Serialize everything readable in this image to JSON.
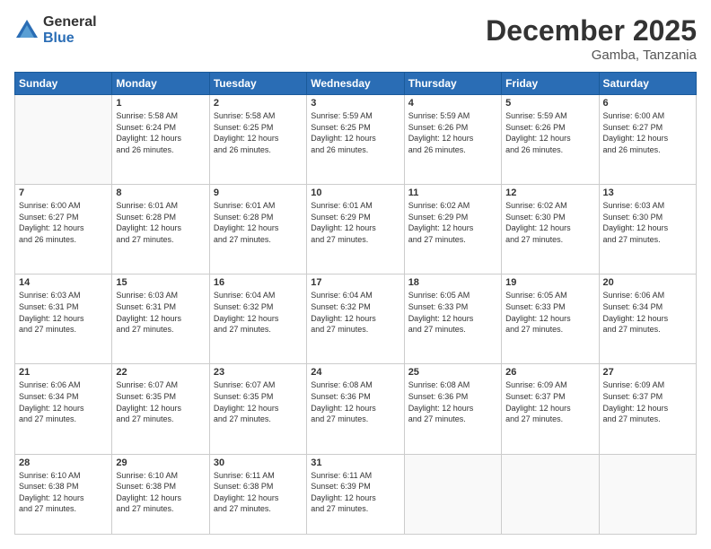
{
  "logo": {
    "general": "General",
    "blue": "Blue"
  },
  "header": {
    "month": "December 2025",
    "location": "Gamba, Tanzania"
  },
  "weekdays": [
    "Sunday",
    "Monday",
    "Tuesday",
    "Wednesday",
    "Thursday",
    "Friday",
    "Saturday"
  ],
  "weeks": [
    [
      {
        "day": "",
        "sunrise": "",
        "sunset": "",
        "daylight": ""
      },
      {
        "day": "1",
        "sunrise": "Sunrise: 5:58 AM",
        "sunset": "Sunset: 6:24 PM",
        "daylight": "Daylight: 12 hours and 26 minutes."
      },
      {
        "day": "2",
        "sunrise": "Sunrise: 5:58 AM",
        "sunset": "Sunset: 6:25 PM",
        "daylight": "Daylight: 12 hours and 26 minutes."
      },
      {
        "day": "3",
        "sunrise": "Sunrise: 5:59 AM",
        "sunset": "Sunset: 6:25 PM",
        "daylight": "Daylight: 12 hours and 26 minutes."
      },
      {
        "day": "4",
        "sunrise": "Sunrise: 5:59 AM",
        "sunset": "Sunset: 6:26 PM",
        "daylight": "Daylight: 12 hours and 26 minutes."
      },
      {
        "day": "5",
        "sunrise": "Sunrise: 5:59 AM",
        "sunset": "Sunset: 6:26 PM",
        "daylight": "Daylight: 12 hours and 26 minutes."
      },
      {
        "day": "6",
        "sunrise": "Sunrise: 6:00 AM",
        "sunset": "Sunset: 6:27 PM",
        "daylight": "Daylight: 12 hours and 26 minutes."
      }
    ],
    [
      {
        "day": "7",
        "sunrise": "Sunrise: 6:00 AM",
        "sunset": "Sunset: 6:27 PM",
        "daylight": "Daylight: 12 hours and 26 minutes."
      },
      {
        "day": "8",
        "sunrise": "Sunrise: 6:01 AM",
        "sunset": "Sunset: 6:28 PM",
        "daylight": "Daylight: 12 hours and 27 minutes."
      },
      {
        "day": "9",
        "sunrise": "Sunrise: 6:01 AM",
        "sunset": "Sunset: 6:28 PM",
        "daylight": "Daylight: 12 hours and 27 minutes."
      },
      {
        "day": "10",
        "sunrise": "Sunrise: 6:01 AM",
        "sunset": "Sunset: 6:29 PM",
        "daylight": "Daylight: 12 hours and 27 minutes."
      },
      {
        "day": "11",
        "sunrise": "Sunrise: 6:02 AM",
        "sunset": "Sunset: 6:29 PM",
        "daylight": "Daylight: 12 hours and 27 minutes."
      },
      {
        "day": "12",
        "sunrise": "Sunrise: 6:02 AM",
        "sunset": "Sunset: 6:30 PM",
        "daylight": "Daylight: 12 hours and 27 minutes."
      },
      {
        "day": "13",
        "sunrise": "Sunrise: 6:03 AM",
        "sunset": "Sunset: 6:30 PM",
        "daylight": "Daylight: 12 hours and 27 minutes."
      }
    ],
    [
      {
        "day": "14",
        "sunrise": "Sunrise: 6:03 AM",
        "sunset": "Sunset: 6:31 PM",
        "daylight": "Daylight: 12 hours and 27 minutes."
      },
      {
        "day": "15",
        "sunrise": "Sunrise: 6:03 AM",
        "sunset": "Sunset: 6:31 PM",
        "daylight": "Daylight: 12 hours and 27 minutes."
      },
      {
        "day": "16",
        "sunrise": "Sunrise: 6:04 AM",
        "sunset": "Sunset: 6:32 PM",
        "daylight": "Daylight: 12 hours and 27 minutes."
      },
      {
        "day": "17",
        "sunrise": "Sunrise: 6:04 AM",
        "sunset": "Sunset: 6:32 PM",
        "daylight": "Daylight: 12 hours and 27 minutes."
      },
      {
        "day": "18",
        "sunrise": "Sunrise: 6:05 AM",
        "sunset": "Sunset: 6:33 PM",
        "daylight": "Daylight: 12 hours and 27 minutes."
      },
      {
        "day": "19",
        "sunrise": "Sunrise: 6:05 AM",
        "sunset": "Sunset: 6:33 PM",
        "daylight": "Daylight: 12 hours and 27 minutes."
      },
      {
        "day": "20",
        "sunrise": "Sunrise: 6:06 AM",
        "sunset": "Sunset: 6:34 PM",
        "daylight": "Daylight: 12 hours and 27 minutes."
      }
    ],
    [
      {
        "day": "21",
        "sunrise": "Sunrise: 6:06 AM",
        "sunset": "Sunset: 6:34 PM",
        "daylight": "Daylight: 12 hours and 27 minutes."
      },
      {
        "day": "22",
        "sunrise": "Sunrise: 6:07 AM",
        "sunset": "Sunset: 6:35 PM",
        "daylight": "Daylight: 12 hours and 27 minutes."
      },
      {
        "day": "23",
        "sunrise": "Sunrise: 6:07 AM",
        "sunset": "Sunset: 6:35 PM",
        "daylight": "Daylight: 12 hours and 27 minutes."
      },
      {
        "day": "24",
        "sunrise": "Sunrise: 6:08 AM",
        "sunset": "Sunset: 6:36 PM",
        "daylight": "Daylight: 12 hours and 27 minutes."
      },
      {
        "day": "25",
        "sunrise": "Sunrise: 6:08 AM",
        "sunset": "Sunset: 6:36 PM",
        "daylight": "Daylight: 12 hours and 27 minutes."
      },
      {
        "day": "26",
        "sunrise": "Sunrise: 6:09 AM",
        "sunset": "Sunset: 6:37 PM",
        "daylight": "Daylight: 12 hours and 27 minutes."
      },
      {
        "day": "27",
        "sunrise": "Sunrise: 6:09 AM",
        "sunset": "Sunset: 6:37 PM",
        "daylight": "Daylight: 12 hours and 27 minutes."
      }
    ],
    [
      {
        "day": "28",
        "sunrise": "Sunrise: 6:10 AM",
        "sunset": "Sunset: 6:38 PM",
        "daylight": "Daylight: 12 hours and 27 minutes."
      },
      {
        "day": "29",
        "sunrise": "Sunrise: 6:10 AM",
        "sunset": "Sunset: 6:38 PM",
        "daylight": "Daylight: 12 hours and 27 minutes."
      },
      {
        "day": "30",
        "sunrise": "Sunrise: 6:11 AM",
        "sunset": "Sunset: 6:38 PM",
        "daylight": "Daylight: 12 hours and 27 minutes."
      },
      {
        "day": "31",
        "sunrise": "Sunrise: 6:11 AM",
        "sunset": "Sunset: 6:39 PM",
        "daylight": "Daylight: 12 hours and 27 minutes."
      },
      {
        "day": "",
        "sunrise": "",
        "sunset": "",
        "daylight": ""
      },
      {
        "day": "",
        "sunrise": "",
        "sunset": "",
        "daylight": ""
      },
      {
        "day": "",
        "sunrise": "",
        "sunset": "",
        "daylight": ""
      }
    ]
  ]
}
